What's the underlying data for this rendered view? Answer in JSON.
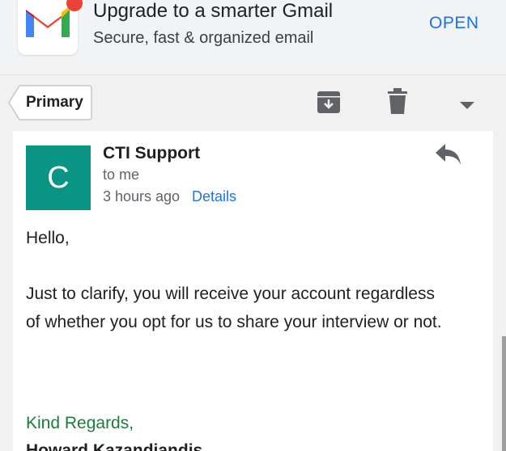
{
  "banner": {
    "title": "Upgrade to a smarter Gmail",
    "subtitle": "Secure, fast & organized email",
    "open_label": "OPEN",
    "icon": "gmail-logo"
  },
  "toolbar": {
    "label": "Primary",
    "icons": [
      "archive-icon",
      "delete-icon",
      "more-dropdown-icon"
    ]
  },
  "email": {
    "avatar_letter": "C",
    "sender": "CTI Support",
    "recipient": "to me",
    "time": "3 hours ago",
    "details_label": "Details",
    "greeting": "Hello,",
    "body_line1": "Just to clarify, you will receive your account regardless",
    "body_line2": "of whether you opt for us to share your interview or not.",
    "closing": "Kind Regards,",
    "signature": "Howard Kazandjandis"
  },
  "colors": {
    "accent_blue": "#1a73e8",
    "avatar_teal": "#0a9483",
    "closing_green": "#188038"
  }
}
